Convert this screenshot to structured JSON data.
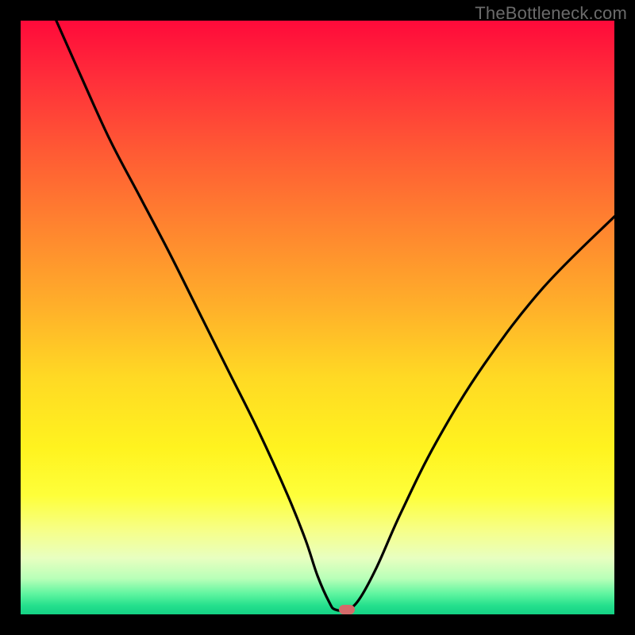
{
  "watermark": "TheBottleneck.com",
  "marker_color": "#d46a6a",
  "gradient_stops": [
    {
      "offset": 0.0,
      "color": "#ff0a3a"
    },
    {
      "offset": 0.1,
      "color": "#ff2f3a"
    },
    {
      "offset": 0.22,
      "color": "#ff5a34"
    },
    {
      "offset": 0.35,
      "color": "#ff852f"
    },
    {
      "offset": 0.48,
      "color": "#ffaf2a"
    },
    {
      "offset": 0.6,
      "color": "#ffd924"
    },
    {
      "offset": 0.72,
      "color": "#fff31f"
    },
    {
      "offset": 0.8,
      "color": "#feff3a"
    },
    {
      "offset": 0.86,
      "color": "#f6ff8a"
    },
    {
      "offset": 0.905,
      "color": "#e8ffc0"
    },
    {
      "offset": 0.94,
      "color": "#b8ffb8"
    },
    {
      "offset": 0.965,
      "color": "#60f5a0"
    },
    {
      "offset": 0.985,
      "color": "#25e08d"
    },
    {
      "offset": 1.0,
      "color": "#14d184"
    }
  ],
  "chart_data": {
    "type": "line",
    "title": "",
    "xlabel": "",
    "ylabel": "",
    "x_range": [
      0,
      100
    ],
    "y_range": [
      0,
      100
    ],
    "minimum_at_x": 53,
    "marker": {
      "x": 55,
      "y": 0.8
    },
    "series": [
      {
        "name": "bottleneck-curve",
        "x": [
          6,
          10,
          15,
          20,
          25,
          30,
          35,
          40,
          45,
          48,
          50,
          52,
          53,
          55,
          57,
          60,
          64,
          70,
          78,
          88,
          100
        ],
        "y": [
          100,
          91,
          80,
          70.5,
          61,
          51,
          41,
          31,
          20,
          12.5,
          6.5,
          2,
          0.8,
          0.8,
          2.5,
          8,
          17,
          29,
          42,
          55,
          67
        ]
      }
    ]
  }
}
